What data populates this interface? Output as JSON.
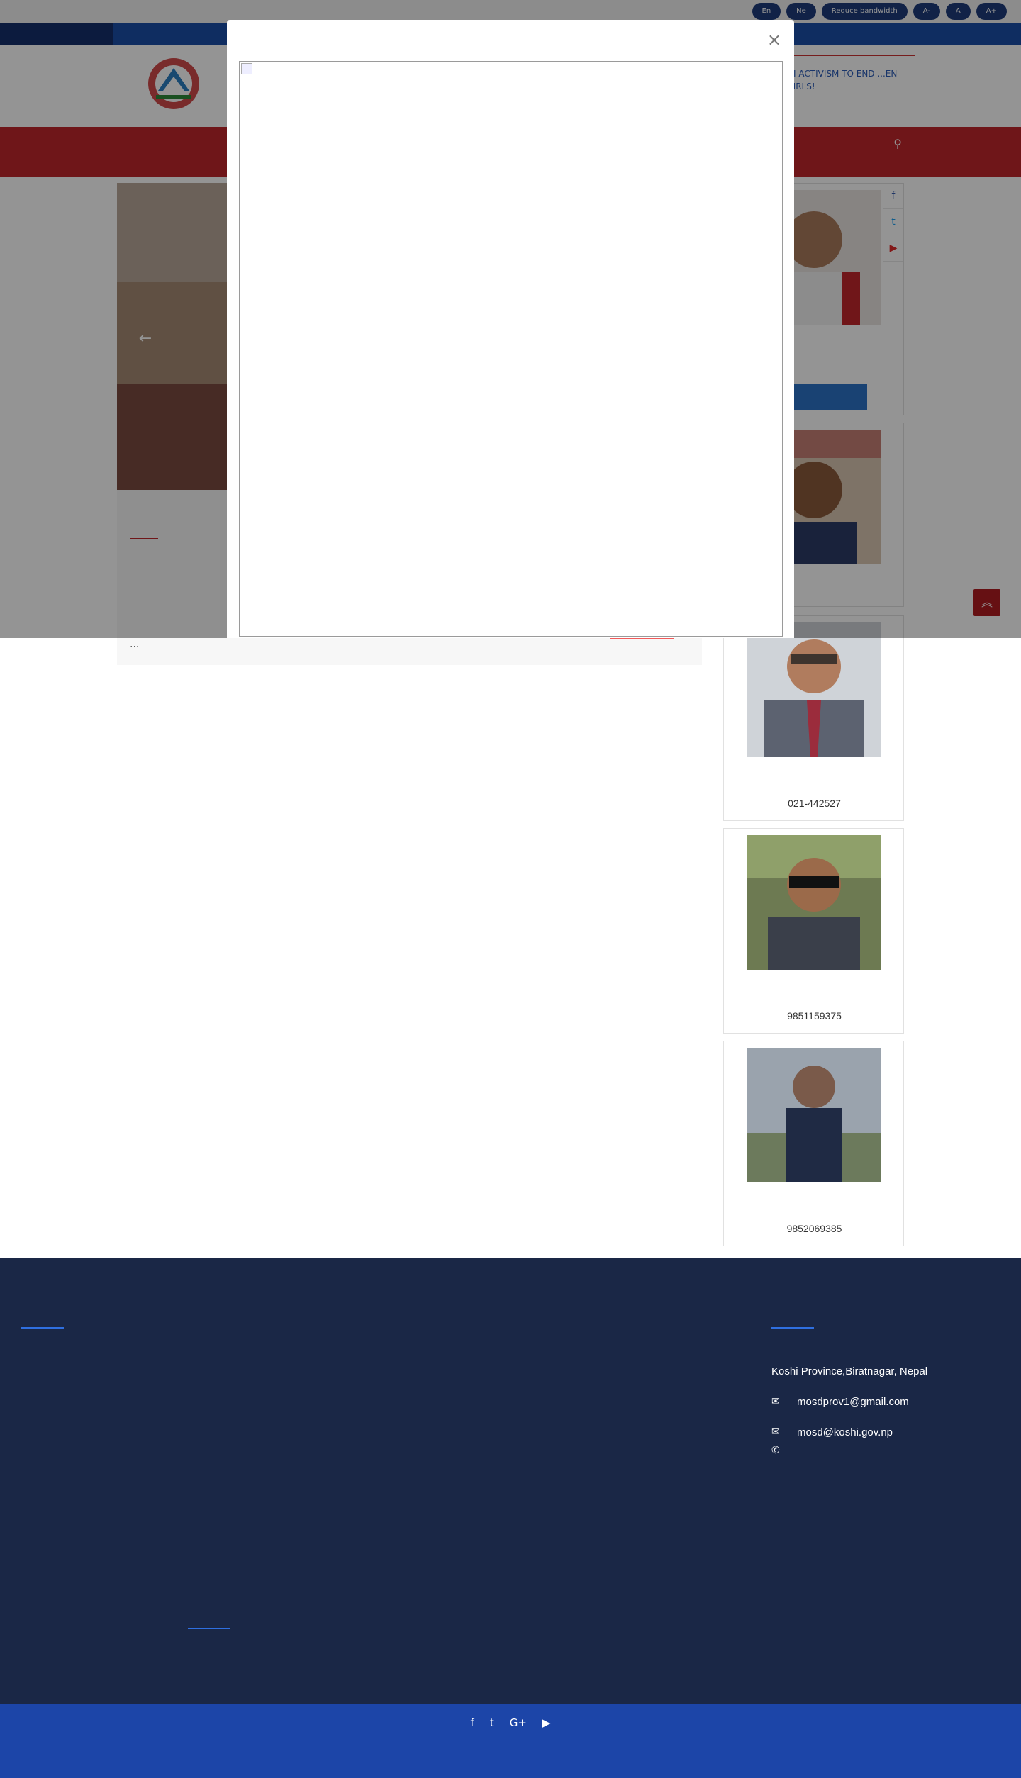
{
  "topbar": {
    "lang_en": "En",
    "lang_ne": "Ne",
    "reduce_bandwidth": "Reduce bandwidth",
    "font_minus": "A-",
    "font_normal": "A",
    "font_plus": "A+"
  },
  "datebar": {
    "date": "",
    "links": [
      "",
      "",
      ""
    ]
  },
  "ticker": {
    "text": "...EI ACTIVISM TO END ...EN &GIRLS!"
  },
  "nav": {
    "items": [
      "",
      "",
      ""
    ]
  },
  "article": {
    "title": "",
    "body": "",
    "ellipsis": "..."
  },
  "officials": [
    {
      "name": "",
      "role": "",
      "button": ""
    },
    {
      "name": "",
      "role": ""
    },
    {
      "name": "",
      "role": "",
      "phone": "021-442527"
    },
    {
      "name": "",
      "role": "",
      "phone": "9851159375"
    },
    {
      "name": "",
      "role": "",
      "phone": "9852069385"
    }
  ],
  "modal": {
    "title": "",
    "close": "×"
  },
  "footer": {
    "col1_title": "",
    "col2_title": "",
    "col3_title": "",
    "links": [
      "",
      "",
      "",
      "",
      "",
      "",
      "",
      "",
      ""
    ],
    "address": "Koshi Province,Biratnagar, Nepal",
    "email1": "mosdprov1@gmail.com",
    "email2": "mosd@koshi.gov.np",
    "phone": ""
  },
  "copyright": {
    "line1": "",
    "line2": ""
  },
  "colors": {
    "primary_blue": "#1b4ea8",
    "nav_red": "#c0262c",
    "footer_navy": "#1a2746",
    "copyright_blue": "#1c45a8",
    "link_blue": "#2b73c6"
  },
  "icons": {
    "facebook": "facebook-icon",
    "twitter": "twitter-icon",
    "youtube": "youtube-icon",
    "google_plus": "google-plus-icon",
    "search": "search-icon",
    "close": "close-icon",
    "scroll_top": "chevron-double-up-icon",
    "envelope": "envelope-icon",
    "phone": "phone-icon",
    "arrow_left": "arrow-left-icon"
  }
}
